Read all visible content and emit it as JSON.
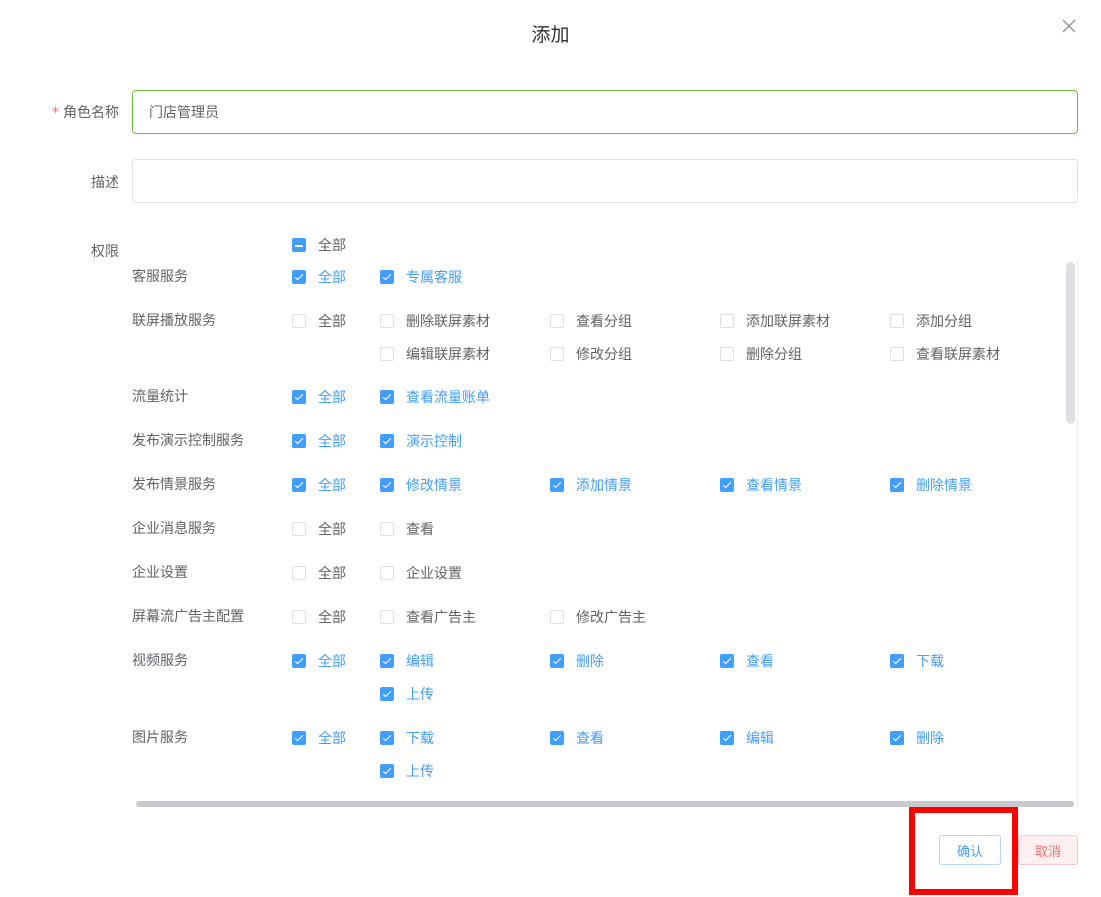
{
  "dialog": {
    "title": "添加"
  },
  "form": {
    "role_name": {
      "required_star": "*",
      "label": "角色名称",
      "value": "门店管理员"
    },
    "description": {
      "label": "描述",
      "value": ""
    },
    "permissions_label": "权限",
    "select_all": {
      "label": "全部",
      "state": "indeterminate"
    }
  },
  "permissions": [
    {
      "name": "客服服务",
      "all": {
        "label": "全部",
        "checked": true
      },
      "items": [
        {
          "label": "专属客服",
          "checked": true
        }
      ]
    },
    {
      "name": "联屏播放服务",
      "all": {
        "label": "全部",
        "checked": false
      },
      "items": [
        {
          "label": "删除联屏素材",
          "checked": false
        },
        {
          "label": "查看分组",
          "checked": false
        },
        {
          "label": "添加联屏素材",
          "checked": false
        },
        {
          "label": "添加分组",
          "checked": false
        },
        {
          "label": "编辑联屏素材",
          "checked": false
        },
        {
          "label": "修改分组",
          "checked": false
        },
        {
          "label": "删除分组",
          "checked": false
        },
        {
          "label": "查看联屏素材",
          "checked": false
        }
      ]
    },
    {
      "name": "流量统计",
      "all": {
        "label": "全部",
        "checked": true
      },
      "items": [
        {
          "label": "查看流量账单",
          "checked": true
        }
      ]
    },
    {
      "name": "发布演示控制服务",
      "all": {
        "label": "全部",
        "checked": true
      },
      "items": [
        {
          "label": "演示控制",
          "checked": true
        }
      ]
    },
    {
      "name": "发布情景服务",
      "all": {
        "label": "全部",
        "checked": true
      },
      "items": [
        {
          "label": "修改情景",
          "checked": true
        },
        {
          "label": "添加情景",
          "checked": true
        },
        {
          "label": "查看情景",
          "checked": true
        },
        {
          "label": "删除情景",
          "checked": true
        }
      ]
    },
    {
      "name": "企业消息服务",
      "all": {
        "label": "全部",
        "checked": false
      },
      "items": [
        {
          "label": "查看",
          "checked": false
        }
      ]
    },
    {
      "name": "企业设置",
      "all": {
        "label": "全部",
        "checked": false
      },
      "items": [
        {
          "label": "企业设置",
          "checked": false
        }
      ]
    },
    {
      "name": "屏幕流广告主配置",
      "all": {
        "label": "全部",
        "checked": false
      },
      "items": [
        {
          "label": "查看广告主",
          "checked": false
        },
        {
          "label": "修改广告主",
          "checked": false
        }
      ]
    },
    {
      "name": "视频服务",
      "all": {
        "label": "全部",
        "checked": true
      },
      "items": [
        {
          "label": "编辑",
          "checked": true
        },
        {
          "label": "删除",
          "checked": true
        },
        {
          "label": "查看",
          "checked": true
        },
        {
          "label": "下载",
          "checked": true
        },
        {
          "label": "上传",
          "checked": true
        }
      ]
    },
    {
      "name": "图片服务",
      "all": {
        "label": "全部",
        "checked": true
      },
      "items": [
        {
          "label": "下载",
          "checked": true
        },
        {
          "label": "查看",
          "checked": true
        },
        {
          "label": "编辑",
          "checked": true
        },
        {
          "label": "删除",
          "checked": true
        },
        {
          "label": "上传",
          "checked": true
        }
      ]
    }
  ],
  "footer": {
    "confirm_label": "确认",
    "cancel_label": "取消"
  },
  "colors": {
    "primary": "#409eff",
    "danger": "#f56c6c",
    "success_border": "#67c23a",
    "highlight": "#ff0000"
  },
  "icons": {
    "close": "close-icon"
  }
}
